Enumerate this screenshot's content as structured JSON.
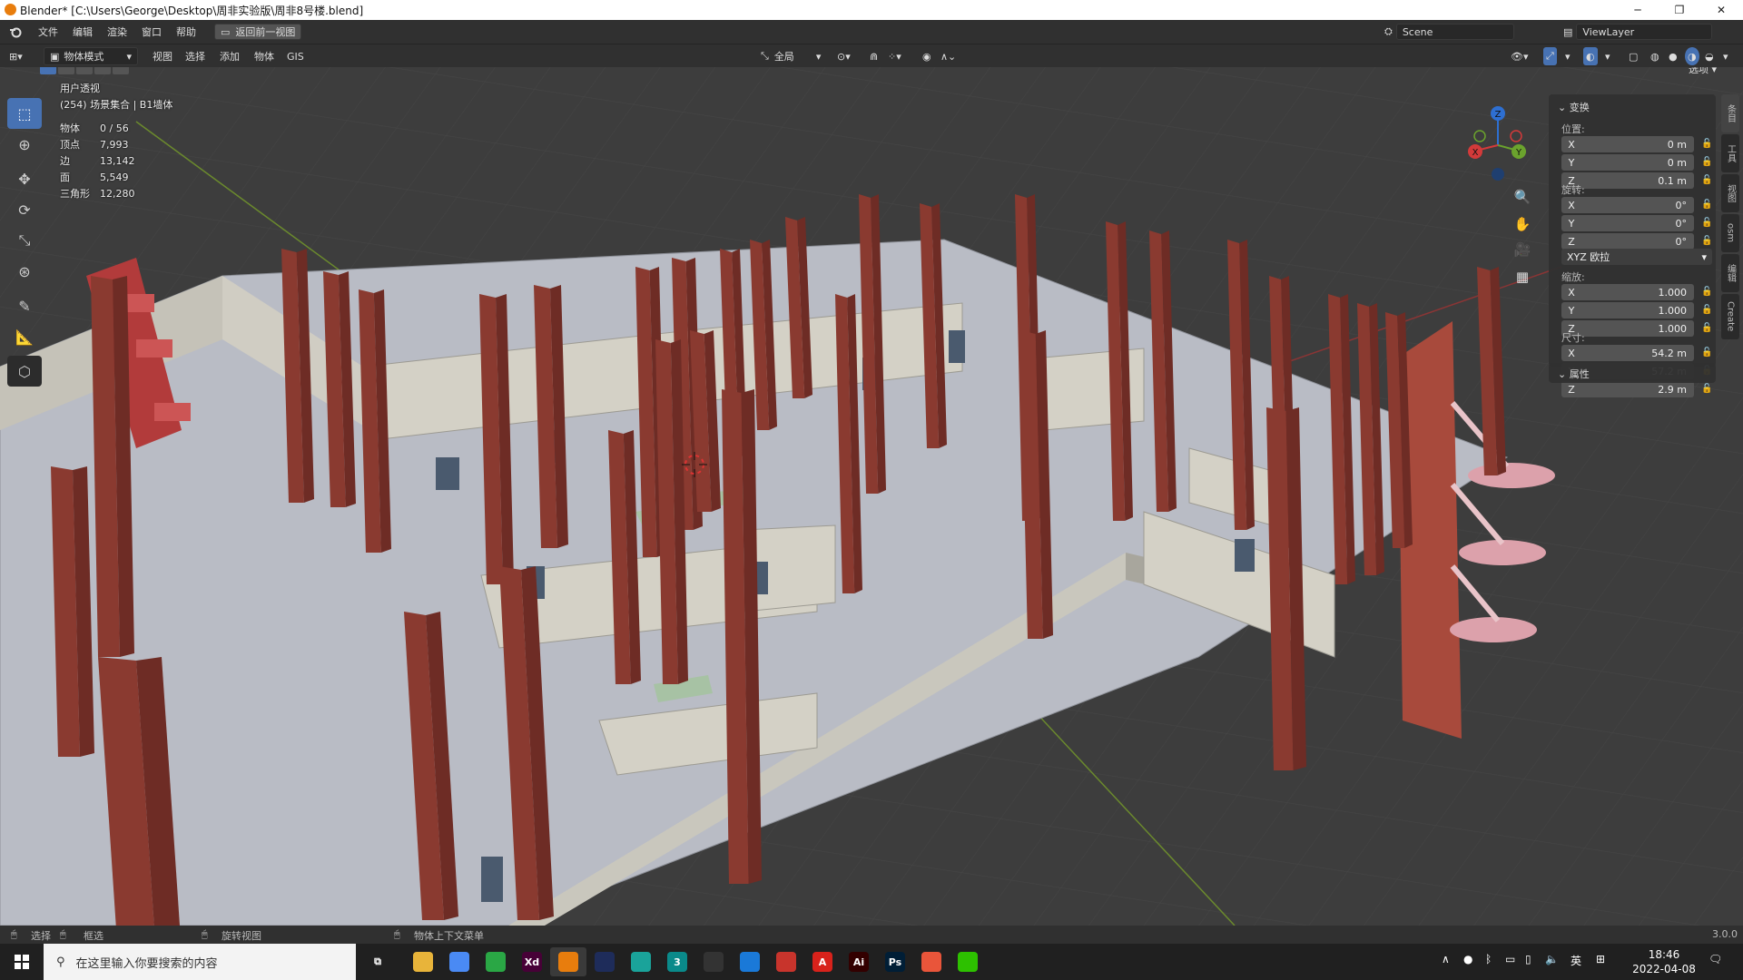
{
  "window": {
    "title": "Blender* [C:\\Users\\George\\Desktop\\周非实验版\\周非8号楼.blend]",
    "minimize": "─",
    "restore": "❐",
    "close": "✕"
  },
  "menubar": {
    "items": [
      "文件",
      "编辑",
      "渲染",
      "窗口",
      "帮助"
    ],
    "back_button": "返回前一视图",
    "scene_label": "Scene",
    "viewlayer_label": "ViewLayer"
  },
  "viewport_header": {
    "mode": "物体模式",
    "menus": [
      "视图",
      "选择",
      "添加",
      "物体",
      "GIS"
    ],
    "transform_orientation": "全局",
    "options": "选项"
  },
  "overlay_text": {
    "view_name": "用户透视",
    "collection": "(254) 场景集合 | B1墙体",
    "stats": [
      {
        "label": "物体",
        "value": "0 / 56"
      },
      {
        "label": "顶点",
        "value": "7,993"
      },
      {
        "label": "边",
        "value": "13,142"
      },
      {
        "label": "面",
        "value": "5,549"
      },
      {
        "label": "三角形",
        "value": "12,280"
      }
    ]
  },
  "gizmo": {
    "x": "X",
    "y": "Y",
    "z": "Z"
  },
  "npanel": {
    "transform_title": "变换",
    "location_label": "位置:",
    "location": [
      {
        "axis": "X",
        "value": "0 m"
      },
      {
        "axis": "Y",
        "value": "0 m"
      },
      {
        "axis": "Z",
        "value": "0.1 m"
      }
    ],
    "rotation_label": "旋转:",
    "rotation": [
      {
        "axis": "X",
        "value": "0°"
      },
      {
        "axis": "Y",
        "value": "0°"
      },
      {
        "axis": "Z",
        "value": "0°"
      }
    ],
    "rotation_mode": "XYZ 欧拉",
    "scale_label": "缩放:",
    "scale": [
      {
        "axis": "X",
        "value": "1.000"
      },
      {
        "axis": "Y",
        "value": "1.000"
      },
      {
        "axis": "Z",
        "value": "1.000"
      }
    ],
    "dimensions_label": "尺寸:",
    "dimensions": [
      {
        "axis": "X",
        "value": "54.2 m"
      },
      {
        "axis": "Y",
        "value": "57.2 m"
      },
      {
        "axis": "Z",
        "value": "2.9 m"
      }
    ],
    "properties_title": "属性"
  },
  "side_tabs": [
    "条目",
    "工具",
    "视图",
    "osm",
    "编辑",
    "Create"
  ],
  "statusbar": {
    "select": "选择",
    "box_select": "框选",
    "rotate_view": "旋转视图",
    "context_menu": "物体上下文菜单",
    "version": "3.0.0"
  },
  "taskbar": {
    "search_placeholder": "在这里输入你要搜索的内容",
    "apps": [
      {
        "name": "file-explorer",
        "label": "",
        "color": "#e8b43a"
      },
      {
        "name": "chrome",
        "label": "",
        "color": "#4a8af4"
      },
      {
        "name": "green-app",
        "label": "",
        "color": "#2aa745"
      },
      {
        "name": "adobe-xd",
        "label": "Xd",
        "color": "#470137"
      },
      {
        "name": "blender",
        "label": "",
        "color": "#e87d0d"
      },
      {
        "name": "cinema4d",
        "label": "",
        "color": "#1e2c5a"
      },
      {
        "name": "teal-app",
        "label": "",
        "color": "#1aa39a"
      },
      {
        "name": "3dsmax",
        "label": "3",
        "color": "#0a8a8a"
      },
      {
        "name": "unity",
        "label": "",
        "color": "#333333"
      },
      {
        "name": "blue-circle-app",
        "label": "",
        "color": "#1a79d8"
      },
      {
        "name": "red-app",
        "label": "",
        "color": "#c8342c"
      },
      {
        "name": "acrobat",
        "label": "A",
        "color": "#d8221b"
      },
      {
        "name": "illustrator",
        "label": "Ai",
        "color": "#330000"
      },
      {
        "name": "photoshop",
        "label": "Ps",
        "color": "#001e36"
      },
      {
        "name": "figma-app",
        "label": "",
        "color": "#e9553a"
      },
      {
        "name": "wechat",
        "label": "",
        "color": "#2dc100"
      }
    ],
    "ime": "英",
    "time": "18:46",
    "date": "2022-04-08"
  }
}
